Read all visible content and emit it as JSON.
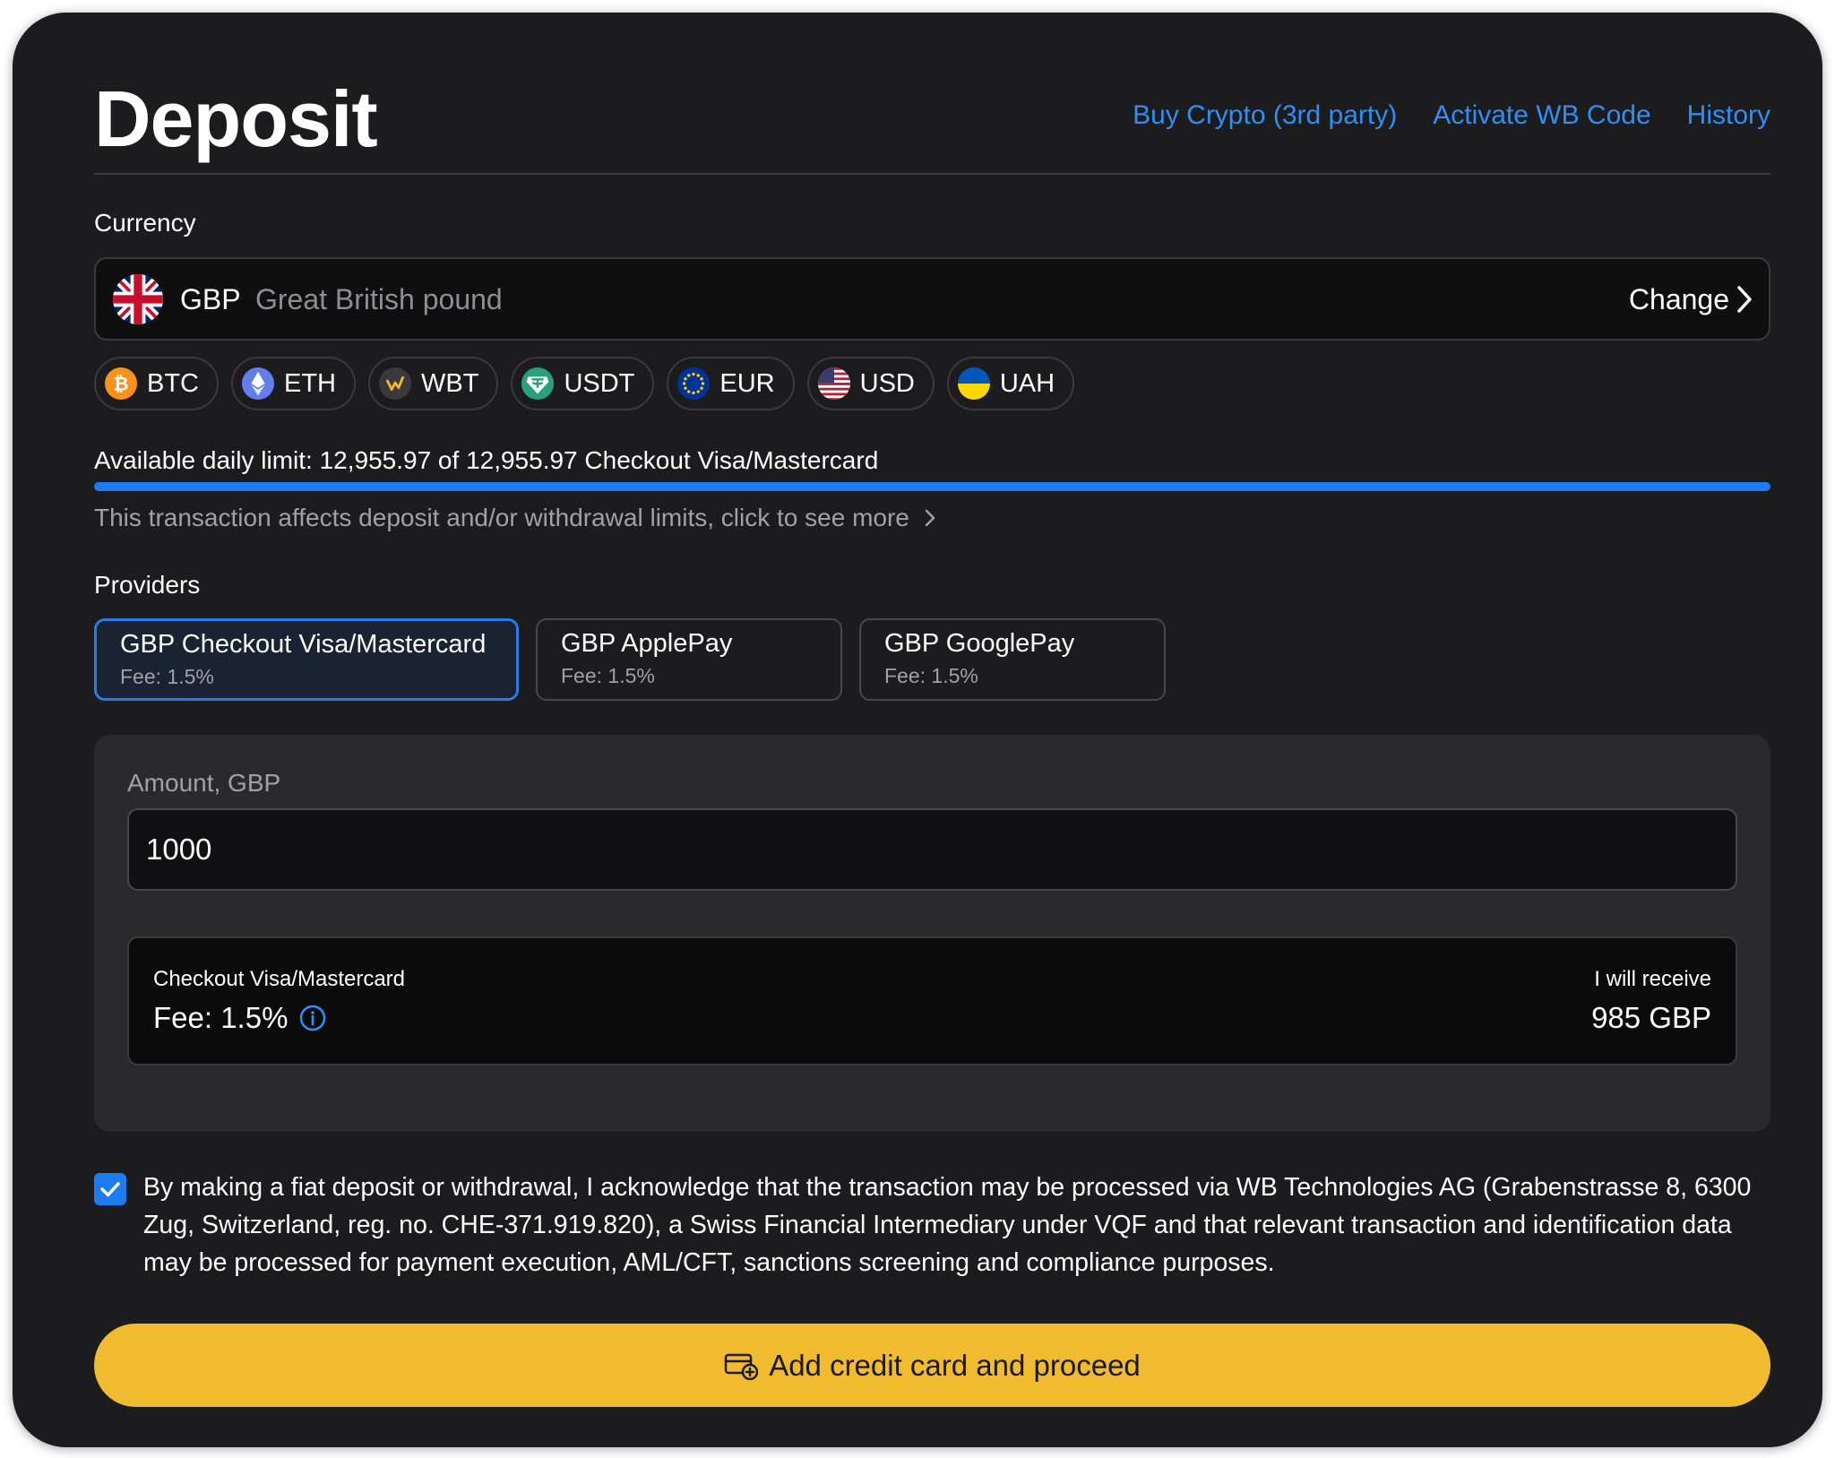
{
  "header": {
    "title": "Deposit",
    "links": [
      "Buy Crypto (3rd party)",
      "Activate WB Code",
      "History"
    ]
  },
  "currency": {
    "section_label": "Currency",
    "code": "GBP",
    "name": "Great British pound",
    "change_label": "Change",
    "icon": "uk-flag-icon"
  },
  "quick_currencies": [
    {
      "code": "BTC",
      "icon": "bitcoin-icon",
      "color": "#f7931a"
    },
    {
      "code": "ETH",
      "icon": "ethereum-icon",
      "color": "#627eea"
    },
    {
      "code": "WBT",
      "icon": "whitebit-icon",
      "color": "#3a3a3c"
    },
    {
      "code": "USDT",
      "icon": "tether-icon",
      "color": "#26a17b"
    },
    {
      "code": "EUR",
      "icon": "eu-flag-icon",
      "color": "#003399"
    },
    {
      "code": "USD",
      "icon": "us-flag-icon",
      "color": "#b22234"
    },
    {
      "code": "UAH",
      "icon": "ukraine-flag-icon",
      "color": "#0057b7"
    }
  ],
  "limits": {
    "text": "Available daily limit: 12,955.97 of 12,955.97 Checkout Visa/Mastercard",
    "available_fraction": 1.0,
    "bar_color": "#1e7cf2",
    "note": "This transaction affects deposit and/or withdrawal limits, click to see more"
  },
  "providers": {
    "section_label": "Providers",
    "items": [
      {
        "name": "GBP Checkout Visa/Mastercard",
        "fee": "Fee: 1.5%",
        "selected": true
      },
      {
        "name": "GBP ApplePay",
        "fee": "Fee: 1.5%",
        "selected": false
      },
      {
        "name": "GBP GooglePay",
        "fee": "Fee: 1.5%",
        "selected": false
      }
    ]
  },
  "amount": {
    "label": "Amount, GBP",
    "value": "1000"
  },
  "summary": {
    "provider": "Checkout Visa/Mastercard",
    "fee": "Fee: 1.5%",
    "receive_label": "I will receive",
    "receive_value": "985 GBP"
  },
  "consent": {
    "checked": true,
    "text": "By making a fiat deposit or withdrawal, I acknowledge that the transaction may be processed via WB Technologies AG (Grabenstrasse 8, 6300 Zug, Switzerland, reg. no. CHE-371.919.820), a Swiss Financial Intermediary under VQF and that relevant transaction and identification data may be processed for payment execution, AML/CFT, sanctions screening and compliance purposes."
  },
  "cta": {
    "label": "Add credit card and proceed",
    "icon": "add-card-icon",
    "color": "#f0bb2e"
  },
  "colors": {
    "accent": "#2f8ff5",
    "background": "#1c1c1e"
  }
}
